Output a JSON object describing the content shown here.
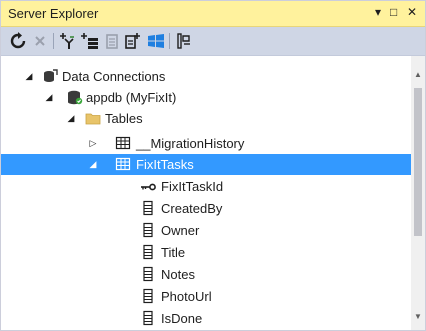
{
  "window": {
    "title": "Server Explorer",
    "pin_glyph": "▾",
    "maximize_glyph": "□",
    "close_glyph": "✕"
  },
  "toolbar": {
    "icons": [
      "refresh-icon",
      "stop-icon",
      "connect-to-database-icon",
      "connect-to-server-icon",
      "connect-to-sharepoint-icon",
      "connect-to-azure-icon",
      "windows-azure-icon",
      "properties-icon"
    ]
  },
  "tree": [
    {
      "label": "Data Connections",
      "expanded": true,
      "selected": false,
      "icon": "data-connections-icon"
    },
    {
      "label": "appdb (MyFixIt)",
      "expanded": true,
      "selected": false,
      "icon": "database-icon"
    },
    {
      "label": "Tables",
      "expanded": true,
      "selected": false,
      "icon": "folder-icon"
    },
    {
      "label": "__MigrationHistory",
      "expanded": false,
      "selected": false,
      "icon": "table-icon"
    },
    {
      "label": "FixItTasks",
      "expanded": true,
      "selected": true,
      "icon": "table-icon"
    },
    {
      "label": "FixItTaskId",
      "selected": false,
      "icon": "primary-key-icon"
    },
    {
      "label": "CreatedBy",
      "selected": false,
      "icon": "column-icon"
    },
    {
      "label": "Owner",
      "selected": false,
      "icon": "column-icon"
    },
    {
      "label": "Title",
      "selected": false,
      "icon": "column-icon"
    },
    {
      "label": "Notes",
      "selected": false,
      "icon": "column-icon"
    },
    {
      "label": "PhotoUrl",
      "selected": false,
      "icon": "column-icon"
    },
    {
      "label": "IsDone",
      "selected": false,
      "icon": "column-icon"
    }
  ],
  "colors": {
    "title_bar": "#fff29d",
    "toolbar": "#cfd6e5",
    "selection": "#3399ff"
  }
}
